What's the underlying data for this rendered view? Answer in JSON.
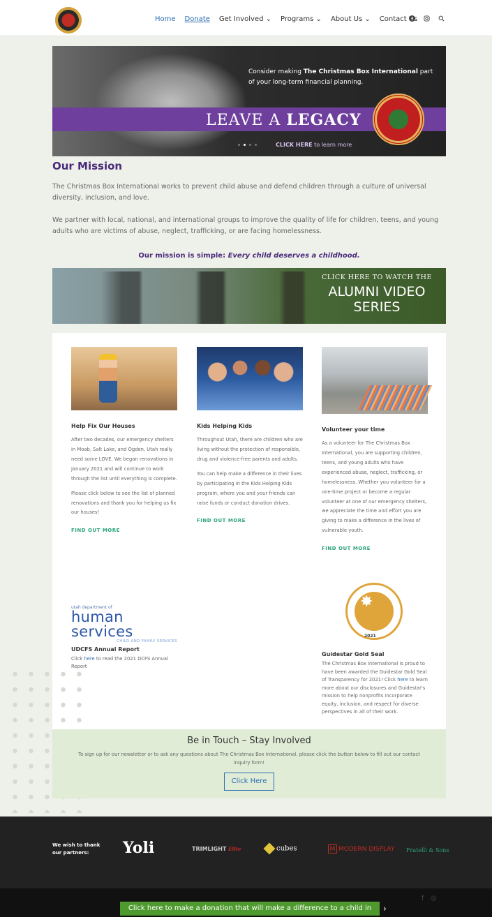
{
  "nav": {
    "items": [
      "Home",
      "Donate",
      "Get Involved ⌄",
      "Programs ⌄",
      "About Us ⌄",
      "Contact Us"
    ],
    "icons": [
      "facebook-icon",
      "instagram-icon",
      "search-icon"
    ]
  },
  "hero": {
    "line1_prefix": "Consider making ",
    "line1_bold": "The Christmas Box International",
    "line1_suffix": " part",
    "line2": "of your long-term financial planning.",
    "title_a": "LEAVE A ",
    "title_b": "LEGACY",
    "cta_bold": "CLICK HERE",
    "cta_rest": " to learn more"
  },
  "mission": {
    "title": "Our Mission",
    "p1": "The Christmas Box International works to prevent child abuse and defend children through a culture of universal diversity, inclusion, and love.",
    "p2": "We partner with local, national, and international groups to improve the quality of life for children, teens, and young adults who are victims of abuse, neglect, trafficking, or are facing homelessness.",
    "simple_prefix": "Our mission is simple: ",
    "simple_em": "Every child deserves a childhood."
  },
  "alumni": {
    "line1": "CLICK HERE TO WATCH THE",
    "line2a": "ALUMNI VIDEO",
    "line2b": "SERIES"
  },
  "cards": [
    {
      "title": "Help Fix Our Houses",
      "p1": "After two decades, our emergency shelters in Moab, Salt Lake, and Ogden, Utah really need some LOVE. We began renovations in January 2021 and will continue to work through the list until everything is complete.",
      "p2": "Please click below to see the list of planned renovations and thank you for helping us fix our houses!",
      "more": "FIND OUT MORE"
    },
    {
      "title": "Kids Helping Kids",
      "p1": "Throughout Utah, there are children who are living without the protection of responsible, drug and violence-free parents and adults.",
      "p2": "You can help make a difference in their lives by participating in the Kids Helping Kids program, where you and your friends can raise funds or conduct donation drives.",
      "more": "FIND OUT MORE"
    },
    {
      "title": "Volunteer your time",
      "p1": "As a volunteer for The Christmas Box International, you are supporting children, teens, and young adults who have experienced abuse, neglect, trafficking, or homelessness. Whether you volunteer for a one-time project or become a regular volunteer at one of our emergency shelters, we appreciate the time and effort you are giving to make a difference in the lives of vulnerable youth.",
      "more": "FIND OUT MORE"
    }
  ],
  "dhs": {
    "small": "utah department of",
    "big_a": "human",
    "big_b": " services",
    "sub": "CHILD AND FAMILY SERVICES"
  },
  "udcfs": {
    "title": "UDCFS Annual Report",
    "pre": "Click ",
    "link": "here",
    "post": " to read the 2021 DCFS Annual Report"
  },
  "guidestar": {
    "seal_year": "2021",
    "title": "Guidestar Gold Seal",
    "pre": "The Christmas Box International is proud to have been awarded the Guidestar Gold Seal of Transparency for 2021! Click ",
    "link": "here",
    "post": " to learn more about our disclosures and Guidestar's mission to help nonprofits incorporate equity, inclusion, and respect for diverse perspectives in all of their work."
  },
  "touch": {
    "title": "Be in Touch – Stay Involved",
    "text": "To sign up for our newsletter or to ask any questions about The Christmas Box International, please click the button below to fill out our contact inquiry form!",
    "button": "Click Here"
  },
  "footer": {
    "thanks": "We wish to thank our partners:",
    "yoli": "Yoli",
    "trim_a": "TRIMLIGHT",
    "trim_b": "Elite",
    "cubes": "cubes",
    "modern_m": "M",
    "modern": "MODERN DISPLAY",
    "ff": "Fratelli & Sons"
  },
  "donate_bar": {
    "text": "Click here to make a donation that will make a difference to a child in need",
    "chevron": "›"
  }
}
